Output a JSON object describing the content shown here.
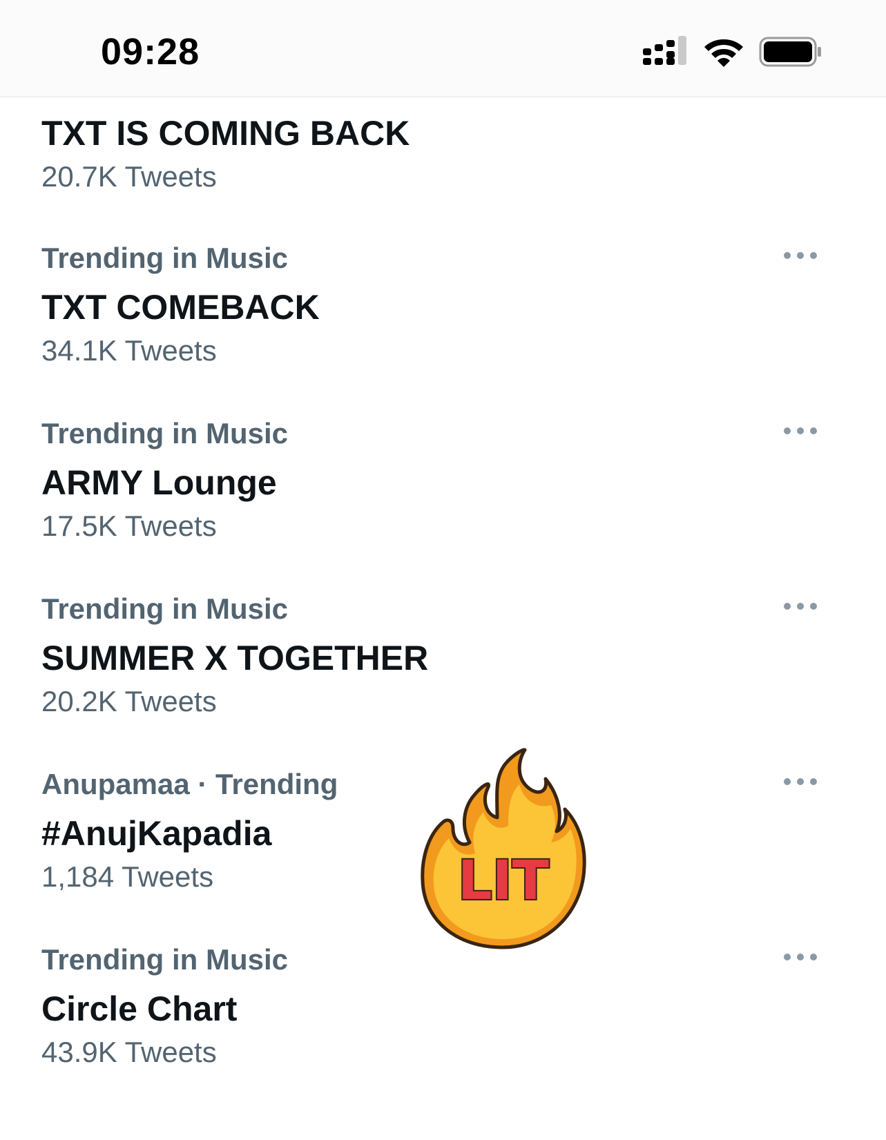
{
  "status_bar": {
    "time": "09:28",
    "icons": [
      "cellular-signal-icon",
      "wifi-icon",
      "battery-icon"
    ]
  },
  "colors": {
    "primary_text": "#0f1419",
    "secondary_text": "#536471",
    "more_dots": "#8b98a5",
    "sticker_flame_outer": "#f29a1d",
    "sticker_flame_inner": "#fcc437",
    "sticker_text": "#e63a45"
  },
  "trends": [
    {
      "context": "",
      "name": "TXT IS COMING BACK",
      "count": "20.7K Tweets"
    },
    {
      "context": "Trending in Music",
      "name": "TXT COMEBACK",
      "count": "34.1K Tweets"
    },
    {
      "context": "Trending in Music",
      "name": "ARMY Lounge",
      "count": "17.5K Tweets"
    },
    {
      "context": "Trending in Music",
      "name": "SUMMER X TOGETHER",
      "count": "20.2K Tweets"
    },
    {
      "context": "Anupamaa · Trending",
      "name": "#AnujKapadia",
      "count": "1,184 Tweets"
    },
    {
      "context": "Trending in Music",
      "name": "Circle Chart",
      "count": "43.9K Tweets"
    }
  ],
  "sticker": {
    "icon": "fire-lit-sticker",
    "text": "LIT"
  }
}
